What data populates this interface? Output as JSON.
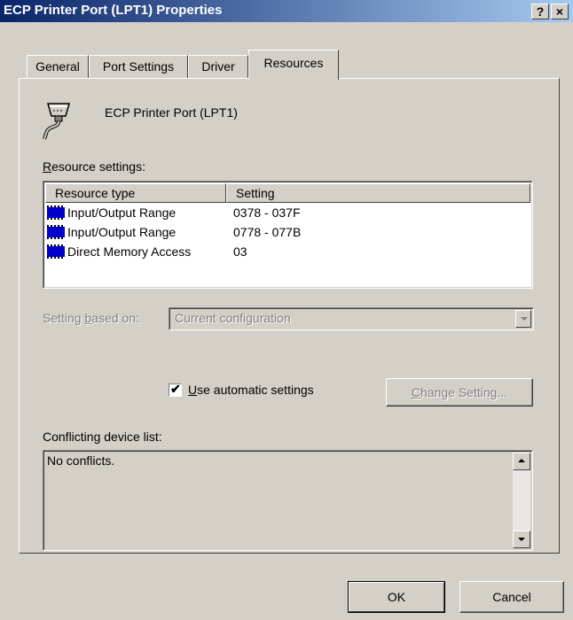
{
  "window": {
    "title": "ECP Printer Port (LPT1) Properties",
    "help_label": "?",
    "close_label": "×"
  },
  "tabs": [
    {
      "label": "General"
    },
    {
      "label": "Port Settings"
    },
    {
      "label": "Driver"
    },
    {
      "label": "Resources"
    }
  ],
  "device": {
    "name": "ECP Printer Port (LPT1)",
    "icon": "printer-port-icon"
  },
  "resources": {
    "label_pre": "",
    "label_accel": "R",
    "label_post": "esource settings:",
    "columns": [
      "Resource type",
      "Setting"
    ],
    "rows": [
      {
        "type": "Input/Output Range",
        "setting": "0378 - 037F"
      },
      {
        "type": "Input/Output Range",
        "setting": "0778 - 077B"
      },
      {
        "type": "Direct Memory Access",
        "setting": "03"
      }
    ]
  },
  "setting_based_on": {
    "label_pre": "Setting ",
    "label_accel": "b",
    "label_post": "ased on:",
    "value": "Current configuration"
  },
  "automatic": {
    "checked": "✔",
    "label_accel": "U",
    "label_post": "se automatic settings"
  },
  "change_setting": {
    "label_accel": "C",
    "label_post": "hange Setting..."
  },
  "conflicts": {
    "label": "Conflicting device list:",
    "text": "No conflicts."
  },
  "buttons": {
    "ok": "OK",
    "cancel": "Cancel"
  }
}
